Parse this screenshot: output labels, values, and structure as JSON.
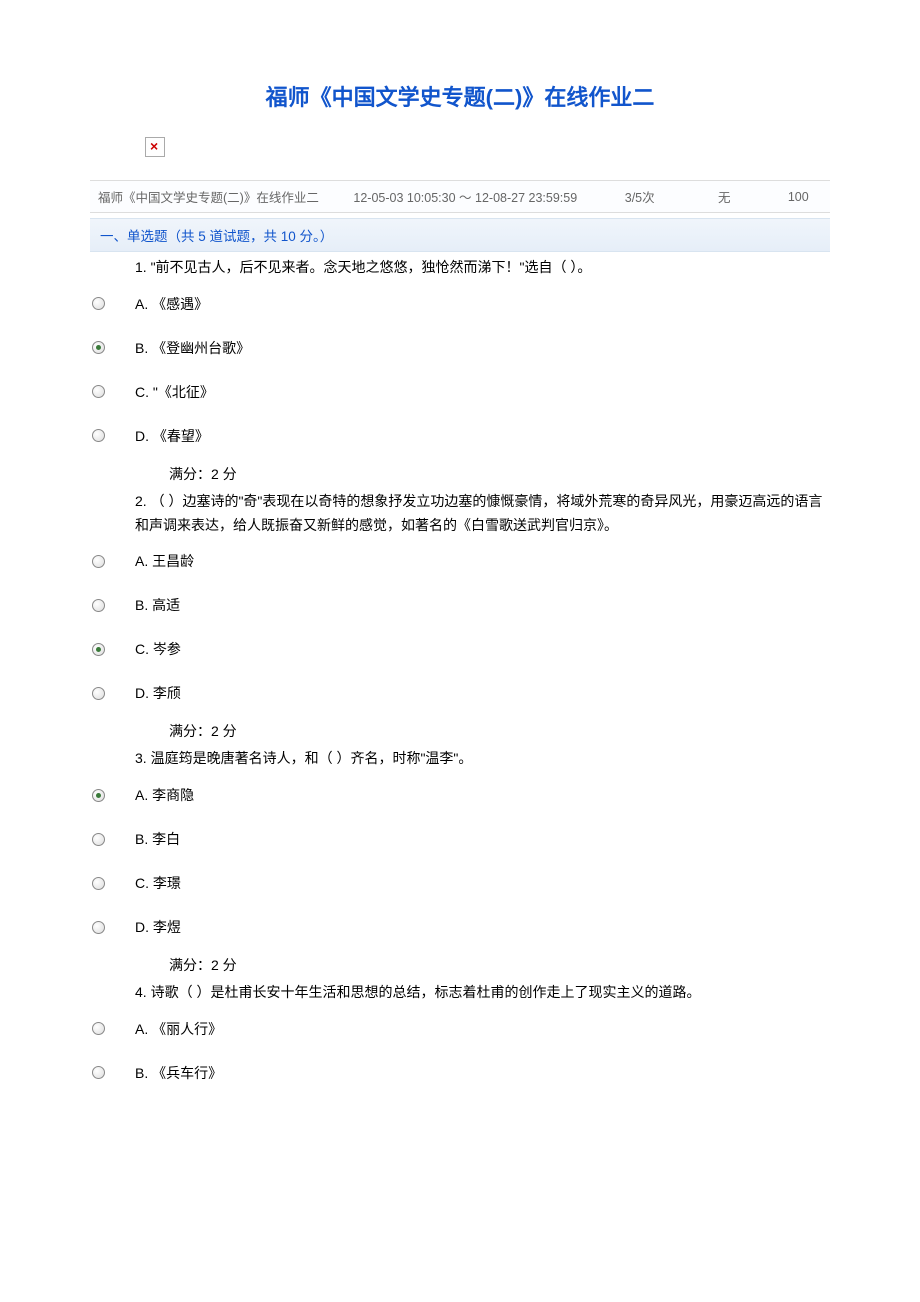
{
  "title": "福师《中国文学史专题(二)》在线作业二",
  "meta": {
    "name": "福师《中国文学史专题(二)》在线作业二",
    "time_range": "12-05-03 10:05:30 ～ 12-08-27 23:59:59",
    "attempts": "3/5次",
    "col4": "无",
    "total": "100"
  },
  "section_header": "一、单选题（共 5 道试题，共 10 分。）",
  "q1": {
    "text": "1. \"前不见古人，后不见来者。念天地之悠悠，独怆然而涕下！\"选自（ ）。",
    "A": "A. 《感遇》",
    "B": "B. 《登幽州台歌》",
    "C": "C. \"《北征》",
    "D": "D. 《春望》",
    "score": "满分：2  分",
    "selected": "B"
  },
  "q2": {
    "text": "2. （ ）边塞诗的\"奇\"表现在以奇特的想象抒发立功边塞的慷慨豪情，将域外荒寒的奇异风光，用豪迈高远的语言和声调来表达，给人既振奋又新鲜的感觉，如著名的《白雪歌送武判官归京》。",
    "A": "A. 王昌龄",
    "B": "B. 高适",
    "C": "C. 岑参",
    "D": "D. 李颀",
    "score": "满分：2  分",
    "selected": "C"
  },
  "q3": {
    "text": "3. 温庭筠是晚唐著名诗人，和（ ）齐名，时称\"温李\"。",
    "A": "A. 李商隐",
    "B": "B. 李白",
    "C": "C. 李璟",
    "D": "D. 李煜",
    "score": "满分：2  分",
    "selected": "A"
  },
  "q4": {
    "text": "4. 诗歌（ ）是杜甫长安十年生活和思想的总结，标志着杜甫的创作走上了现实主义的道路。",
    "A": "A. 《丽人行》",
    "B": "B. 《兵车行》"
  }
}
